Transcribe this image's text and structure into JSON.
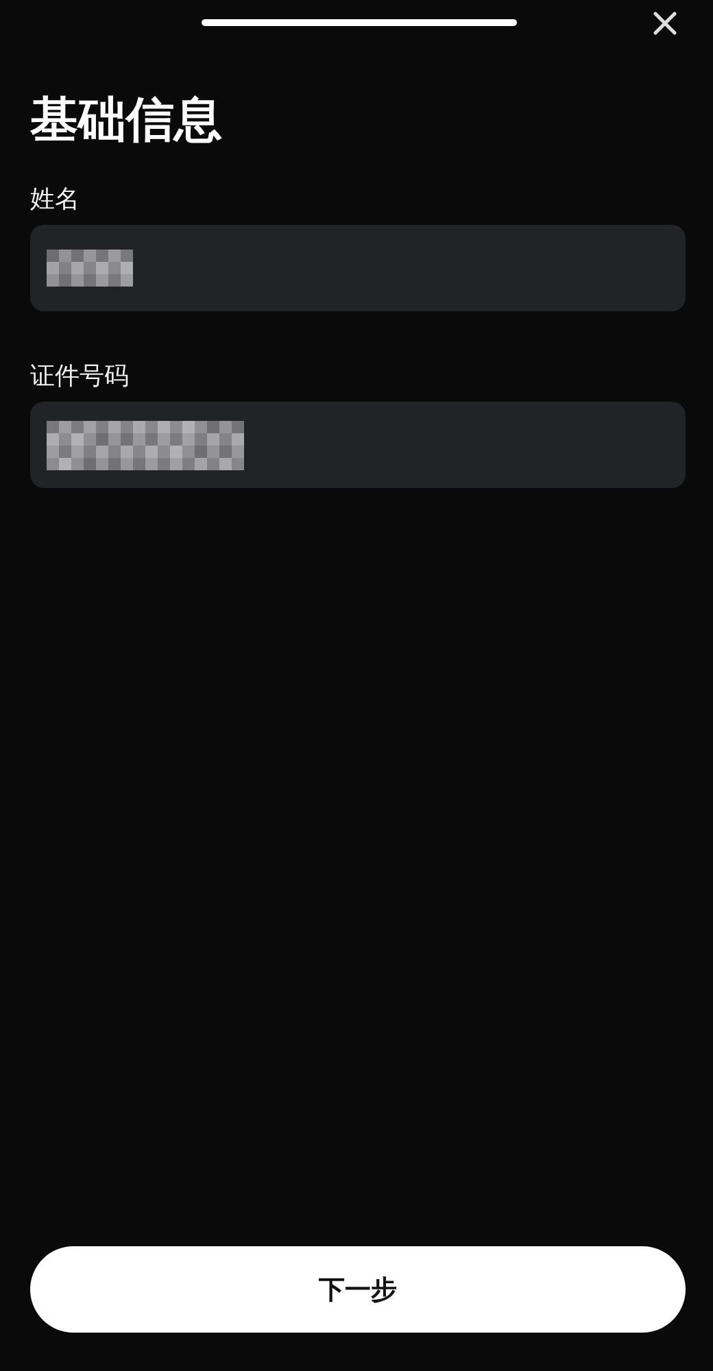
{
  "header": {
    "title": "基础信息"
  },
  "fields": [
    {
      "label": "姓名",
      "kind": "masked"
    },
    {
      "label": "证件号码",
      "kind": "masked"
    }
  ],
  "next_button": {
    "label": "下一步"
  }
}
